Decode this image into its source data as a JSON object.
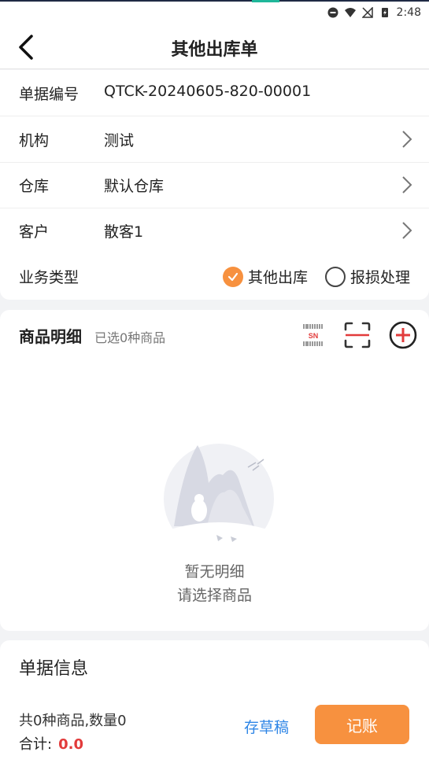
{
  "status_bar": {
    "time": "2:48"
  },
  "nav": {
    "title": "其他出库单"
  },
  "form": {
    "doc_no": {
      "label": "单据编号",
      "value": "QTCK-20240605-820-00001"
    },
    "org": {
      "label": "机构",
      "value": "测试"
    },
    "warehouse": {
      "label": "仓库",
      "value": "默认仓库"
    },
    "customer": {
      "label": "客户",
      "value": "散客1"
    },
    "biz_type": {
      "label": "业务类型",
      "options": [
        {
          "label": "其他出库",
          "selected": true
        },
        {
          "label": "报损处理",
          "selected": false
        }
      ]
    }
  },
  "items": {
    "title": "商品明细",
    "subtitle": "已选0种商品",
    "sn_label": "SN",
    "empty_line1": "暂无明细",
    "empty_line2": "请选择商品"
  },
  "info": {
    "title": "单据信息",
    "summary": "共0种商品,数量0",
    "total_label": "合计:",
    "total_value": "0.0",
    "draft_label": "存草稿",
    "post_label": "记账"
  },
  "colors": {
    "accent": "#f7913f",
    "link": "#2f86e6",
    "danger": "#e23b3b"
  }
}
